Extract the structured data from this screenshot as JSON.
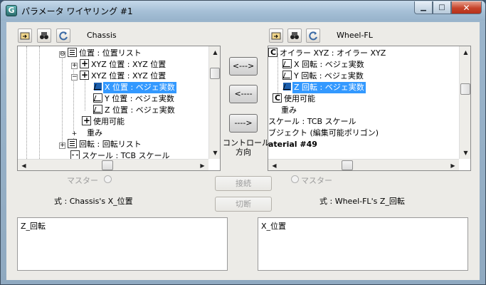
{
  "window": {
    "title": "パラメータ ワイヤリング #1",
    "app_icon_text": "G",
    "buttons": {
      "minimize": "minimize-icon",
      "maximize": "maximize-icon",
      "close": "close-icon"
    }
  },
  "left": {
    "header_name": "Chassis",
    "tree": [
      {
        "label": "位置 : 位置リスト",
        "icon": "list-icon",
        "expander": "⊖"
      },
      {
        "label": "XYZ 位置 : XYZ 位置",
        "icon": "xyz-icon",
        "expander": "+"
      },
      {
        "label": "XYZ 位置 : XYZ 位置",
        "icon": "xyz-icon",
        "expander": "−"
      },
      {
        "label": "X 位置 : ベジェ実数",
        "icon": "bezier-icon",
        "selected": true
      },
      {
        "label": "Y 位置 : ベジェ実数",
        "icon": "bezier-icon"
      },
      {
        "label": "Z 位置 : ベジェ実数",
        "icon": "bezier-icon"
      },
      {
        "label": "使用可能",
        "icon": "xyz-icon"
      },
      {
        "label": "重み",
        "icon": "",
        "expander": "+"
      },
      {
        "label": "回転 : 回転リスト",
        "icon": "list-icon",
        "expander": "+"
      },
      {
        "label": "スケール : TCB スケール",
        "icon": "scale-icon"
      }
    ],
    "master_label": "マスター",
    "expression_label": "式 : Chassis's X_位置",
    "expression_text": "Z_回転"
  },
  "right": {
    "header_name": "Wheel-FL",
    "tree": [
      {
        "label": "オイラー XYZ : オイラー XYZ",
        "icon": "rotation-icon"
      },
      {
        "label": "X 回転 : ベジェ実数",
        "icon": "bezier-icon"
      },
      {
        "label": "Y 回転 : ベジェ実数",
        "icon": "bezier-icon"
      },
      {
        "label": "Z 回転 : ベジェ実数",
        "icon": "bezier-icon",
        "selected": true
      },
      {
        "label": "使用可能",
        "icon": "rotation-icon"
      },
      {
        "label": "重み",
        "icon": ""
      },
      {
        "label": "スケール : TCB スケール",
        "icon": ""
      },
      {
        "label": "ブジェクト (編集可能ポリゴン)",
        "icon": ""
      },
      {
        "label": "aterial #49",
        "icon": "",
        "bold": true
      }
    ],
    "master_label": "マスター",
    "expression_label": "式 : Wheel-FL's Z_回転",
    "expression_text": "X_位置"
  },
  "center": {
    "two_way": "<--->",
    "left_arrow": "<----",
    "right_arrow": "---->",
    "direction_label_1": "コントロール",
    "direction_label_2": "方向",
    "connect": "接続",
    "disconnect": "切断"
  }
}
